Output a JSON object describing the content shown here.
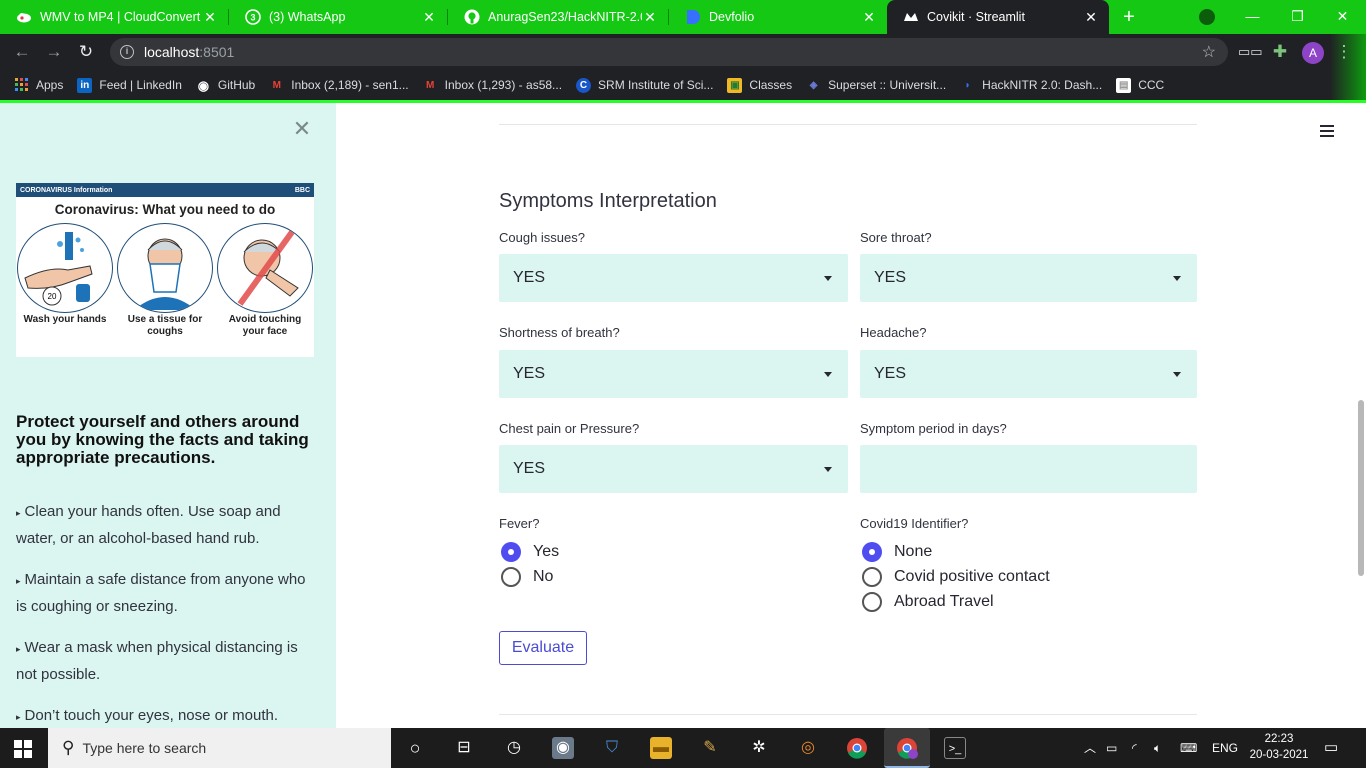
{
  "browser": {
    "tabs": [
      {
        "title": "WMV to MP4 | CloudConvert",
        "icon": "cloud-icon"
      },
      {
        "title": "(3) WhatsApp",
        "icon": "whatsapp-icon",
        "badge": "3"
      },
      {
        "title": "AnuragSen23/HackNITR-2.0-",
        "icon": "github-icon"
      },
      {
        "title": "Devfolio",
        "icon": "devfolio-icon"
      },
      {
        "title": "Covikit · Streamlit",
        "icon": "streamlit-icon"
      }
    ],
    "address": {
      "host": "localhost",
      "port": ":8501"
    },
    "profile_initial": "A",
    "bookmarks": [
      {
        "label": "Apps",
        "icon": "apps-grid-icon"
      },
      {
        "label": "Feed | LinkedIn",
        "icon": "linkedin-icon",
        "glyph": "in"
      },
      {
        "label": "GitHub",
        "icon": "github-icon",
        "glyph": "◉"
      },
      {
        "label": "Inbox (2,189) - sen1...",
        "icon": "gmail-icon",
        "glyph": "M"
      },
      {
        "label": "Inbox (1,293) - as58...",
        "icon": "gmail-icon",
        "glyph": "M"
      },
      {
        "label": "SRM Institute of Sci...",
        "icon": "srm-icon",
        "glyph": "C"
      },
      {
        "label": "Classes",
        "icon": "classroom-icon",
        "glyph": "▣"
      },
      {
        "label": "Superset :: Universit...",
        "icon": "superset-icon",
        "glyph": "◈"
      },
      {
        "label": "HackNITR 2.0: Dash...",
        "icon": "devfolio-icon",
        "glyph": "◗"
      },
      {
        "label": "CCC",
        "icon": "ccc-icon",
        "glyph": "▤"
      }
    ]
  },
  "sidebar": {
    "poster": {
      "banner_left": "CORONAVIRUS Information",
      "banner_right": "BBC",
      "title": "Coronavirus: What you need to do",
      "items": [
        {
          "caption": "Wash your hands"
        },
        {
          "caption": "Use a tissue for coughs"
        },
        {
          "caption": "Avoid touching your face"
        }
      ]
    },
    "heading": "Protect yourself and others around you by knowing the facts and taking appropriate precautions.",
    "tips": [
      "Clean your hands often. Use soap and water, or an alcohol-based hand rub.",
      "Maintain a safe distance from anyone who is coughing or sneezing.",
      "Wear a mask when physical distancing is not possible.",
      "Don’t touch your eyes, nose or mouth."
    ]
  },
  "form": {
    "title": "Symptoms Interpretation",
    "fields": {
      "cough": {
        "label": "Cough issues?",
        "value": "YES"
      },
      "sore_throat": {
        "label": "Sore throat?",
        "value": "YES"
      },
      "breath": {
        "label": "Shortness of breath?",
        "value": "YES"
      },
      "headache": {
        "label": "Headache?",
        "value": "YES"
      },
      "chest": {
        "label": "Chest pain or Pressure?",
        "value": "YES"
      },
      "period": {
        "label": "Symptom period in days?",
        "value": ""
      }
    },
    "fever": {
      "label": "Fever?",
      "options": [
        "Yes",
        "No"
      ],
      "selected": "Yes"
    },
    "covid_identifier": {
      "label": "Covid19 Identifier?",
      "options": [
        "None",
        "Covid positive contact",
        "Abroad Travel"
      ],
      "selected": "None"
    },
    "submit_label": "Evaluate"
  },
  "taskbar": {
    "search_placeholder": "Type here to search",
    "language": "ENG",
    "time": "22:23",
    "date": "20-03-2021"
  }
}
